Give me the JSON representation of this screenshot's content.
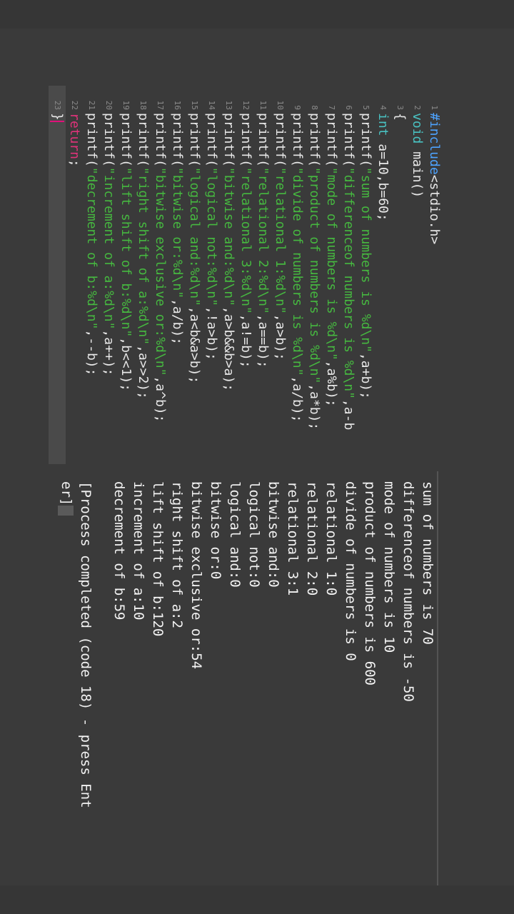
{
  "editor": {
    "lines": [
      {
        "num": "1",
        "parts": [
          {
            "t": "#include",
            "c": "kw-blue"
          },
          {
            "t": "<stdio.h>",
            "c": ""
          }
        ]
      },
      {
        "num": "2",
        "parts": [
          {
            "t": "void",
            "c": "kw-teal"
          },
          {
            "t": " main()",
            "c": ""
          }
        ]
      },
      {
        "num": "3",
        "parts": [
          {
            "t": "{",
            "c": ""
          }
        ]
      },
      {
        "num": "4",
        "parts": [
          {
            "t": "int",
            "c": "kw-teal"
          },
          {
            "t": " a=10,b=60;",
            "c": ""
          }
        ]
      },
      {
        "num": "5",
        "parts": [
          {
            "t": "printf(",
            "c": ""
          },
          {
            "t": "\"sum of numbers is %d\\n\"",
            "c": "str"
          },
          {
            "t": ",a+b);",
            "c": ""
          }
        ]
      },
      {
        "num": "6",
        "parts": [
          {
            "t": "printf(",
            "c": ""
          },
          {
            "t": "\"differenceof numbers is %d\\n\"",
            "c": "str"
          },
          {
            "t": ",a-b",
            "c": ""
          }
        ]
      },
      {
        "num": "7",
        "parts": [
          {
            "t": "printf(",
            "c": ""
          },
          {
            "t": "\"mode of numbers is %d\\n\"",
            "c": "str"
          },
          {
            "t": ",a%b);",
            "c": ""
          }
        ]
      },
      {
        "num": "8",
        "parts": [
          {
            "t": "printf(",
            "c": ""
          },
          {
            "t": "\"product of numbers is %d\\n\"",
            "c": "str"
          },
          {
            "t": ",a*b);",
            "c": ""
          }
        ]
      },
      {
        "num": "9",
        "parts": [
          {
            "t": "printf(",
            "c": ""
          },
          {
            "t": "\"divide of numbers is %d\\n\"",
            "c": "str"
          },
          {
            "t": ",a/b);",
            "c": ""
          }
        ]
      },
      {
        "num": "10",
        "parts": [
          {
            "t": "printf(",
            "c": ""
          },
          {
            "t": "\"relational 1:%d\\n\"",
            "c": "str"
          },
          {
            "t": ",a>b);",
            "c": ""
          }
        ]
      },
      {
        "num": "11",
        "parts": [
          {
            "t": "printf(",
            "c": ""
          },
          {
            "t": "\"relational 2:%d\\n\"",
            "c": "str"
          },
          {
            "t": ",a==b);",
            "c": ""
          }
        ]
      },
      {
        "num": "12",
        "parts": [
          {
            "t": "printf(",
            "c": ""
          },
          {
            "t": "\"relational 3:%d\\n\"",
            "c": "str"
          },
          {
            "t": ",a!=b);",
            "c": ""
          }
        ]
      },
      {
        "num": "13",
        "parts": [
          {
            "t": "printf(",
            "c": ""
          },
          {
            "t": "\"bitwise and:%d\\n\"",
            "c": "str"
          },
          {
            "t": ",a>b&&b>a);",
            "c": ""
          }
        ]
      },
      {
        "num": "14",
        "parts": [
          {
            "t": "printf(",
            "c": ""
          },
          {
            "t": "\"logical not:%d\\n\"",
            "c": "str"
          },
          {
            "t": ",!a>b);",
            "c": ""
          }
        ]
      },
      {
        "num": "15",
        "parts": [
          {
            "t": "printf(",
            "c": ""
          },
          {
            "t": "\"logical and:%d\\n\"",
            "c": "str"
          },
          {
            "t": ",a<b&a>b);",
            "c": ""
          }
        ]
      },
      {
        "num": "16",
        "parts": [
          {
            "t": "printf(",
            "c": ""
          },
          {
            "t": "\"bitwise or:%d\\n\"",
            "c": "str"
          },
          {
            "t": ",a/b);",
            "c": ""
          }
        ]
      },
      {
        "num": "17",
        "parts": [
          {
            "t": "printf(",
            "c": ""
          },
          {
            "t": "\"bitwise exclusive or:%d\\n\"",
            "c": "str"
          },
          {
            "t": ",a^b);",
            "c": ""
          }
        ]
      },
      {
        "num": "18",
        "parts": [
          {
            "t": "printf(",
            "c": ""
          },
          {
            "t": "\"right shift of a:%d\\n\"",
            "c": "str"
          },
          {
            "t": ",a>>2);",
            "c": ""
          }
        ]
      },
      {
        "num": "19",
        "parts": [
          {
            "t": "printf(",
            "c": ""
          },
          {
            "t": "\"lift shift of b:%d\\n\"",
            "c": "str"
          },
          {
            "t": ",b<<1);",
            "c": ""
          }
        ]
      },
      {
        "num": "20",
        "parts": [
          {
            "t": "printf(",
            "c": ""
          },
          {
            "t": "\"increment of a:%d\\n\"",
            "c": "str"
          },
          {
            "t": ",a++);",
            "c": ""
          }
        ]
      },
      {
        "num": "21",
        "parts": [
          {
            "t": "printf(",
            "c": ""
          },
          {
            "t": "\"decrement of b:%d\\n\"",
            "c": "str"
          },
          {
            "t": ",--b);",
            "c": ""
          }
        ]
      },
      {
        "num": "22",
        "parts": [
          {
            "t": "return",
            "c": "kw-pink"
          },
          {
            "t": ";",
            "c": ""
          }
        ]
      },
      {
        "num": "23",
        "parts": [
          {
            "t": "}",
            "c": ""
          }
        ],
        "current": true
      }
    ]
  },
  "output": {
    "lines": [
      "sum of numbers is 70",
      "differenceof numbers is -50",
      "mode of numbers is 10",
      "product of numbers is 600",
      "divide of numbers is 0",
      "relational 1:0",
      "relational 2:0",
      "relational 3:1",
      "bitwise and:0",
      "logical not:0",
      "logical and:0",
      "bitwise or:0",
      "bitwise exclusive or:54",
      "right shift of a:2",
      "lift shift of b:120",
      "increment of a:10",
      "decrement of b:59"
    ],
    "status_line1": "[Process completed (code 18) - press Ent",
    "status_line2": "er]"
  }
}
